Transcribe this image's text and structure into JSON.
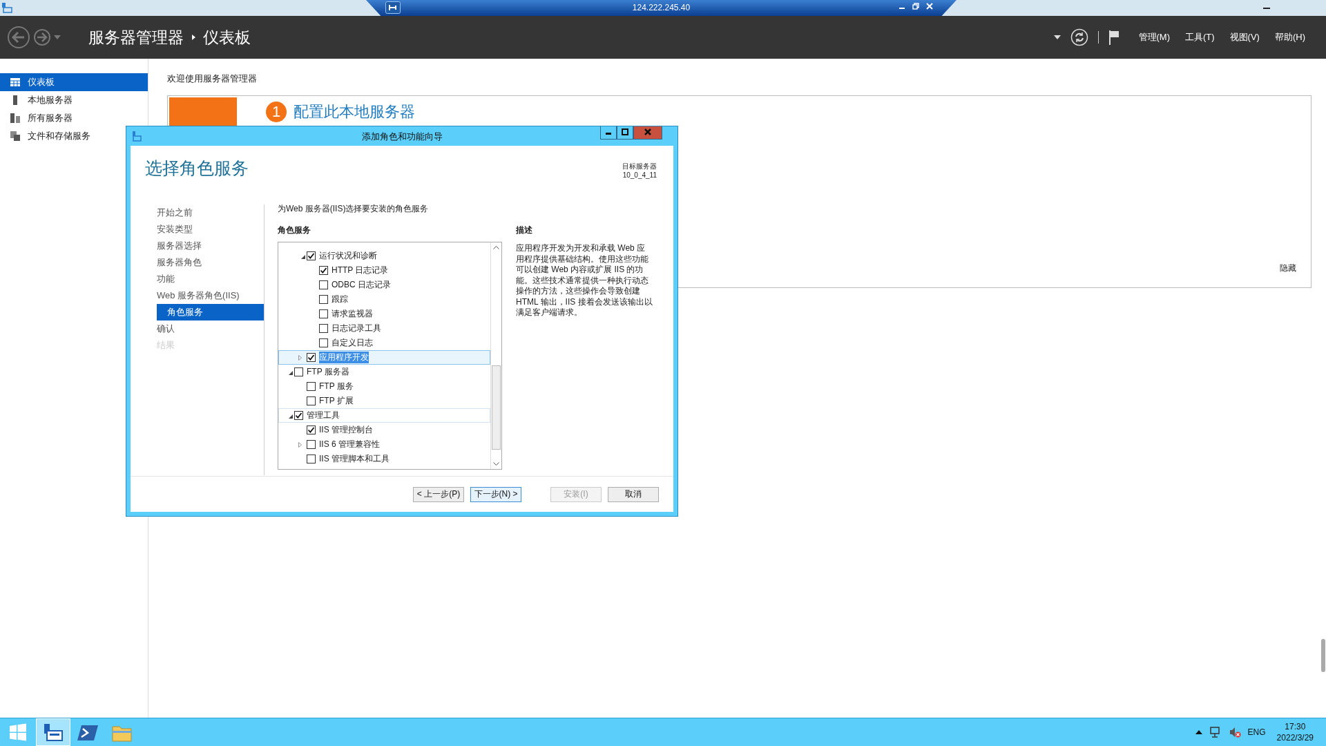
{
  "remote_bar": {
    "address": "124.222.245.40"
  },
  "header": {
    "breadcrumb": [
      "服务器管理器",
      "仪表板"
    ],
    "menus": [
      "管理(M)",
      "工具(T)",
      "视图(V)",
      "帮助(H)"
    ]
  },
  "sidebar": {
    "items": [
      {
        "kind": "dashboard",
        "label": "仪表板",
        "selected": true
      },
      {
        "kind": "local-server",
        "label": "本地服务器",
        "selected": false
      },
      {
        "kind": "all-servers",
        "label": "所有服务器",
        "selected": false
      },
      {
        "kind": "file-storage",
        "label": "文件和存储服务",
        "selected": false
      }
    ]
  },
  "main": {
    "welcome": "欢迎使用服务器管理器",
    "quick_start": {
      "step": "1",
      "title": "配置此本地服务器"
    },
    "hide": "隐藏"
  },
  "dialog": {
    "title": "添加角色和功能向导",
    "heading": "选择角色服务",
    "target_label": "目标服务器",
    "target_server": "10_0_4_11",
    "steps": [
      {
        "label": "开始之前",
        "selected": false,
        "disabled": false
      },
      {
        "label": "安装类型",
        "selected": false,
        "disabled": false
      },
      {
        "label": "服务器选择",
        "selected": false,
        "disabled": false
      },
      {
        "label": "服务器角色",
        "selected": false,
        "disabled": false
      },
      {
        "label": "功能",
        "selected": false,
        "disabled": false
      },
      {
        "label": "Web 服务器角色(IIS)",
        "selected": false,
        "disabled": false,
        "children": [
          {
            "label": "角色服务",
            "selected": true,
            "disabled": false
          }
        ]
      },
      {
        "label": "确认",
        "selected": false,
        "disabled": false
      },
      {
        "label": "结果",
        "selected": false,
        "disabled": true
      }
    ],
    "instruction": "为Web 服务器(IIS)选择要安装的角色服务",
    "tree_title": "角色服务",
    "tree": [
      {
        "children": [
          {
            "label": "运行状况和诊断",
            "checked": true,
            "expanded": true,
            "selected": false,
            "children": [
              {
                "label": "HTTP 日志记录",
                "checked": true,
                "selected": false
              },
              {
                "label": "ODBC 日志记录",
                "checked": false,
                "selected": false
              },
              {
                "label": "跟踪",
                "checked": false,
                "selected": false
              },
              {
                "label": "请求监视器",
                "checked": false,
                "selected": false
              },
              {
                "label": "日志记录工具",
                "checked": false,
                "selected": false
              },
              {
                "label": "自定义日志",
                "checked": false,
                "selected": false
              }
            ]
          },
          {
            "label": "应用程序开发",
            "checked": true,
            "expanded": false,
            "selected": true
          }
        ]
      },
      {
        "label": "FTP 服务器",
        "checked": false,
        "expanded": true,
        "selected": false,
        "children": [
          {
            "label": "FTP 服务",
            "checked": false,
            "selected": false
          },
          {
            "label": "FTP 扩展",
            "checked": false,
            "selected": false
          }
        ]
      },
      {
        "label": "管理工具",
        "checked": true,
        "expanded": true,
        "selected": false,
        "hovered": true,
        "children": [
          {
            "label": "IIS 管理控制台",
            "checked": true,
            "selected": false
          },
          {
            "label": "IIS 6 管理兼容性",
            "checked": false,
            "expanded": false,
            "selected": false
          },
          {
            "label": "IIS 管理脚本和工具",
            "checked": false,
            "selected": false
          }
        ]
      }
    ],
    "description_title": "描述",
    "description": "应用程序开发为开发和承载 Web 应用程序提供基础结构。使用这些功能可以创建 Web 内容或扩展 IIS 的功能。这些技术通常提供一种执行动态操作的方法，这些操作会导致创建 HTML 输出，IIS 接着会发送该输出以满足客户端请求。",
    "buttons": [
      {
        "label": "< 上一步(P)",
        "disabled": false,
        "focused": false
      },
      {
        "label": "下一步(N) >",
        "disabled": false,
        "focused": true
      },
      {
        "label": "安装(I)",
        "disabled": true,
        "focused": false
      },
      {
        "label": "取消",
        "disabled": false,
        "focused": false
      }
    ]
  },
  "taskbar": {
    "apps": [
      {
        "kind": "server-manager",
        "selected": true
      },
      {
        "kind": "powershell",
        "selected": false
      },
      {
        "kind": "file-explorer",
        "selected": false
      }
    ],
    "language": "ENG",
    "time": "17:30",
    "date": "2022/3/29"
  }
}
